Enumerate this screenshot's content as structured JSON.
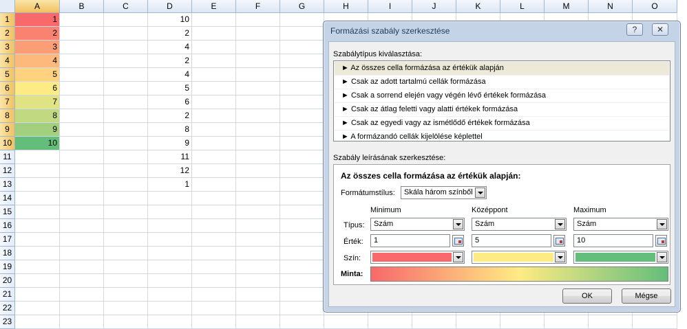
{
  "sheet": {
    "columns": [
      "A",
      "B",
      "C",
      "D",
      "E",
      "F",
      "G",
      "H",
      "I",
      "J",
      "K",
      "L",
      "M",
      "N",
      "O"
    ],
    "selected_column": "A",
    "rows": [
      "1",
      "2",
      "3",
      "4",
      "5",
      "6",
      "7",
      "8",
      "9",
      "10",
      "11",
      "12",
      "13",
      "14",
      "15",
      "16",
      "17",
      "18",
      "19",
      "20",
      "21",
      "22",
      "23"
    ],
    "selected_rows": [
      "1",
      "2",
      "3",
      "4",
      "5",
      "6",
      "7",
      "8",
      "9",
      "10"
    ],
    "column_a": [
      "1",
      "2",
      "3",
      "4",
      "5",
      "6",
      "7",
      "8",
      "9",
      "10"
    ],
    "column_a_colors": [
      "#f8696b",
      "#f98370",
      "#fb9d75",
      "#fdb87b",
      "#ffd27f",
      "#ffeb84",
      "#e0e383",
      "#c1da81",
      "#a2d07f",
      "#63be7b"
    ],
    "column_d": [
      "10",
      "2",
      "4",
      "2",
      "4",
      "5",
      "6",
      "2",
      "8",
      "9",
      "11",
      "12",
      "1"
    ]
  },
  "dialog": {
    "title": "Formázási szabály szerkesztése",
    "help_glyph": "?",
    "close_glyph": "✕",
    "rule_type_label": "Szabálytípus kiválasztása:",
    "rule_types": [
      "► Az összes cella formázása az értékük alapján",
      "► Csak az adott tartalmú cellák formázása",
      "► Csak a sorrend elején vagy végén lévő értékek formázása",
      "► Csak az átlag feletti vagy alatti értékek formázása",
      "► Csak az egyedi vagy az ismétlődő értékek formázása",
      "► A formázandó cellák kijelölése képlettel"
    ],
    "selected_rule_index": 0,
    "description_label": "Szabály leírásának szerkesztése:",
    "description_heading": "Az összes cella formázása az értékük alapján:",
    "format_style_label": "Formátumstílus:",
    "format_style_value": "Skála három színből",
    "columns": {
      "min": "Minimum",
      "mid": "Középpont",
      "max": "Maximum"
    },
    "row_labels": {
      "type": "Típus:",
      "value": "Érték:",
      "color": "Szín:"
    },
    "type_values": {
      "min": "Szám",
      "mid": "Szám",
      "max": "Szám"
    },
    "values": {
      "min": "1",
      "mid": "5",
      "max": "10"
    },
    "colors": {
      "min": "#f8696b",
      "mid": "#ffeb84",
      "max": "#63be7b"
    },
    "sample_label": "Minta:",
    "ok_label": "OK",
    "cancel_label": "Mégse"
  }
}
